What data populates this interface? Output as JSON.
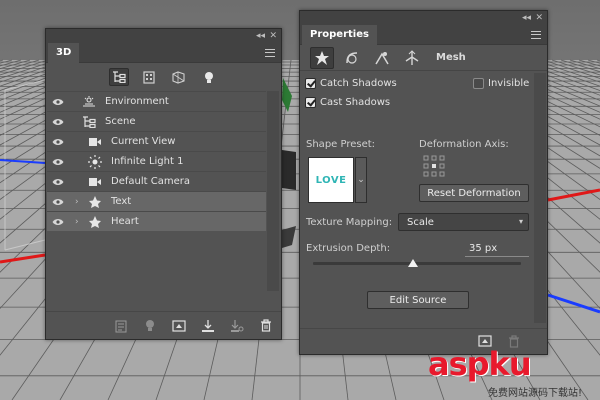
{
  "panel_3d": {
    "title": "3D",
    "filter_icons": [
      "scene-filter-icon",
      "mesh-filter-icon",
      "material-filter-icon",
      "light-filter-icon"
    ],
    "layers": [
      {
        "label": "Environment",
        "icon": "environment-icon",
        "indent": 0,
        "expandable": false,
        "selected": false
      },
      {
        "label": "Scene",
        "icon": "scene-icon",
        "indent": 0,
        "expandable": false,
        "selected": false
      },
      {
        "label": "Current View",
        "icon": "camera-icon",
        "indent": 1,
        "expandable": false,
        "selected": false
      },
      {
        "label": "Infinite Light 1",
        "icon": "infinite-light-icon",
        "indent": 1,
        "expandable": false,
        "selected": false
      },
      {
        "label": "Default Camera",
        "icon": "camera-icon",
        "indent": 1,
        "expandable": false,
        "selected": false
      },
      {
        "label": "Text",
        "icon": "mesh-icon",
        "indent": 1,
        "expandable": true,
        "selected": true
      },
      {
        "label": "Heart",
        "icon": "mesh-icon",
        "indent": 1,
        "expandable": true,
        "selected": true
      }
    ],
    "bottom_tools": [
      "render-icon",
      "light-add-icon",
      "new-mesh-icon",
      "ground-icon",
      "drop-to-plane-icon",
      "trash-icon"
    ]
  },
  "properties": {
    "title": "Properties",
    "mode_label": "Mesh",
    "catch_shadows_label": "Catch Shadows",
    "catch_shadows_checked": true,
    "invisible_label": "Invisible",
    "invisible_checked": false,
    "cast_shadows_label": "Cast Shadows",
    "cast_shadows_checked": true,
    "shape_preset_label": "Shape Preset:",
    "shape_preset_preview_text": "LOVE",
    "deformation_axis_label": "Deformation Axis:",
    "reset_deformation_label": "Reset Deformation",
    "texture_mapping_label": "Texture Mapping:",
    "texture_mapping_value": "Scale",
    "extrusion_depth_label": "Extrusion Depth:",
    "extrusion_depth_value": "35 px",
    "extrusion_slider_fraction": 0.48,
    "edit_source_label": "Edit Source"
  },
  "watermark": {
    "main": "aspku",
    "sub": "免费网站源码下载站!"
  },
  "colors": {
    "panel_bg": "#535353",
    "topbar_bg": "#424242",
    "selected_row": "#676767",
    "axis_red": "#e01818",
    "axis_blue": "#1a3cff",
    "preset_text": "#2fb5b5"
  }
}
